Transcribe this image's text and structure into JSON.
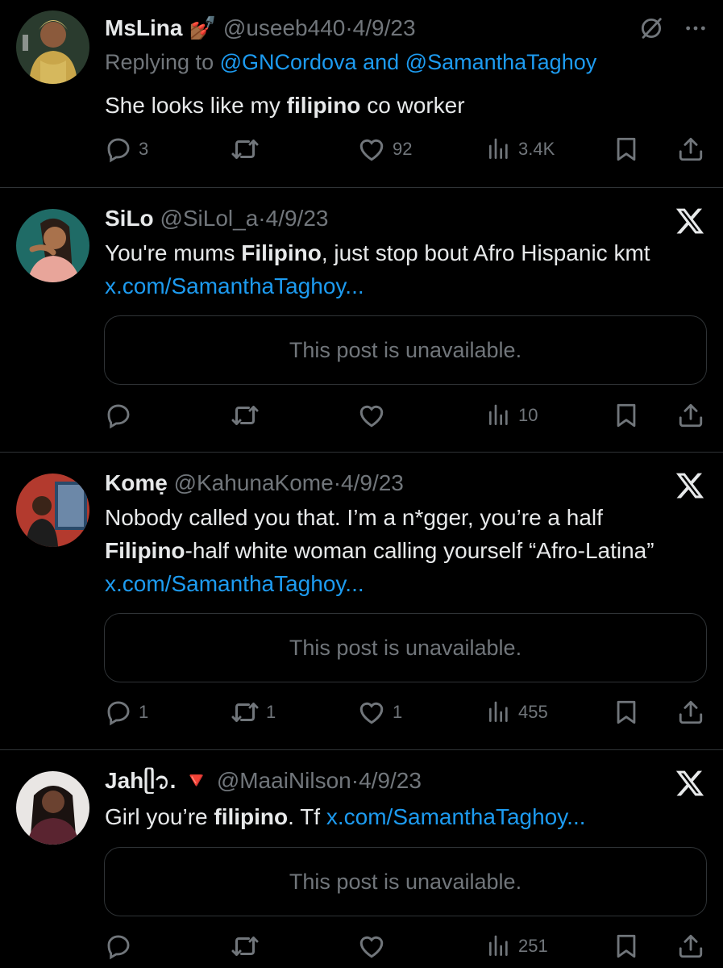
{
  "tweets": [
    {
      "name": "MsLina",
      "name_emoji": "💅🏾",
      "handle": "@useeb440",
      "date": "4/9/23",
      "reply_prefix": "Replying to",
      "reply_user1": "@GNCordova",
      "reply_and": "and",
      "reply_user2": "@SamanthaTaghoy",
      "text_pre": "She looks like my",
      "text_bold": "filipino",
      "text_post": "co worker",
      "replies": "3",
      "retweets": "",
      "likes": "92",
      "views": "3.4K",
      "avatar_color": "#3a4a3a"
    },
    {
      "name": "SiLo",
      "handle": "@SiLol_a",
      "date": "4/9/23",
      "text_pre": "You're mums",
      "text_bold": "Filipino",
      "text_post": ", just stop bout Afro Hispanic kmt",
      "link": "x.com/SamanthaTaghoy...",
      "card": "This post is unavailable.",
      "replies": "",
      "retweets": "",
      "likes": "",
      "views": "10",
      "avatar_color": "#1f6b66"
    },
    {
      "name": "Komẹ",
      "handle": "@KahunaKome",
      "date": "4/9/23",
      "text_pre": "Nobody called you that. I’m a n*gger, you’re a half",
      "text_bold": "Filipino",
      "text_post": "-half white woman calling yourself “Afro-Latina”",
      "link": "x.com/SamanthaTaghoy...",
      "card": "This post is unavailable.",
      "replies": "1",
      "retweets": "1",
      "likes": "1",
      "views": "455",
      "avatar_color": "#b33a2e"
    },
    {
      "name": "Jahᥫ᭡.",
      "name_emoji": "🔻",
      "handle": "@MaaiNilson",
      "date": "4/9/23",
      "text_pre": "Girl you’re",
      "text_bold": "filipino",
      "text_post": ". Tf",
      "link": "x.com/SamanthaTaghoy...",
      "card": "This post is unavailable.",
      "replies": "",
      "retweets": "",
      "likes": "",
      "views": "251",
      "avatar_color": "#6b3b46"
    }
  ],
  "colors": {
    "link": "#1d9bf0",
    "muted": "#71767b",
    "text": "#e7e9ea",
    "divider": "#2f3336"
  }
}
